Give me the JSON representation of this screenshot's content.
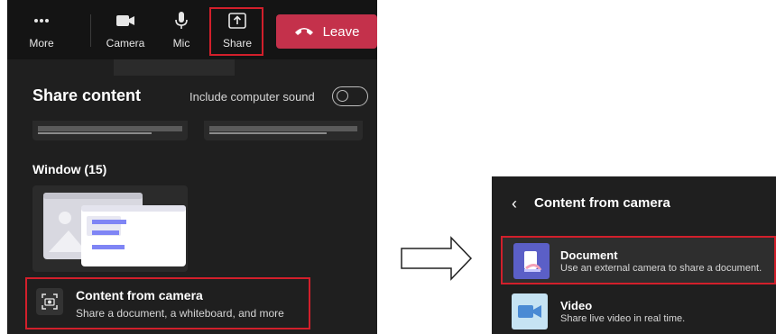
{
  "toolbar": {
    "more_label": "More",
    "camera_label": "Camera",
    "mic_label": "Mic",
    "share_label": "Share",
    "leave_label": "Leave",
    "leave_color": "#c4314b",
    "highlight_color": "#d21f2b"
  },
  "share_panel": {
    "title": "Share content",
    "sound_label": "Include computer sound",
    "sound_enabled": false,
    "window_section_label": "Window (15)",
    "camera_option": {
      "title": "Content from camera",
      "subtitle": "Share a document, a whiteboard, and more"
    }
  },
  "camera_panel": {
    "title": "Content from camera",
    "items": [
      {
        "title": "Document",
        "subtitle": "Use an external camera to share a document.",
        "icon": "document-icon",
        "color": "#5b5fc7"
      },
      {
        "title": "Video",
        "subtitle": "Share live video in real time.",
        "icon": "video-icon",
        "color": "#c6e3f3"
      }
    ]
  }
}
